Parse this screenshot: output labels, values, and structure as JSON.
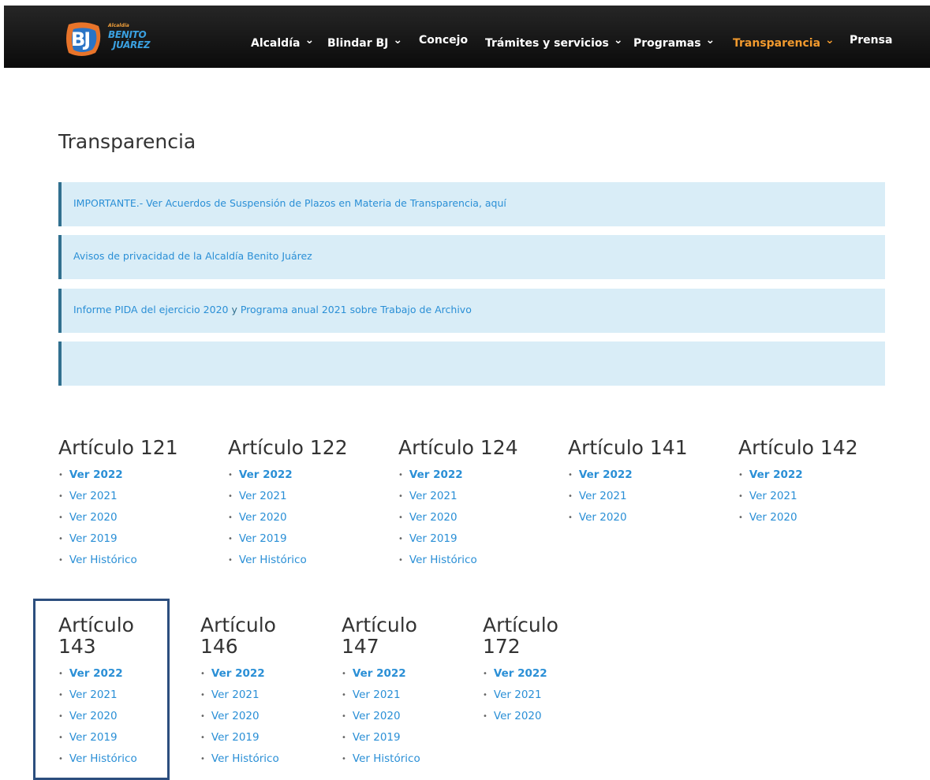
{
  "logo": {
    "small": "Alcaldía",
    "line1": "BENITO",
    "line2": "JUÁREZ",
    "mark": "BJ"
  },
  "nav": [
    {
      "label": "Alcaldía",
      "chevron": true,
      "active": false
    },
    {
      "label": "Blindar BJ",
      "chevron": true,
      "active": false
    },
    {
      "label": "Concejo",
      "chevron": false,
      "active": false
    },
    {
      "label": "Trámites y servicios",
      "chevron": true,
      "active": false
    },
    {
      "label": "Programas",
      "chevron": true,
      "active": false
    },
    {
      "label": "Transparencia",
      "chevron": true,
      "active": true
    },
    {
      "label": "Prensa",
      "chevron": false,
      "active": false
    }
  ],
  "page_title": "Transparencia",
  "notices": [
    {
      "parts": [
        {
          "text": "IMPORTANTE.- Ver Acuerdos de Suspensión de Plazos en Materia de Transparencia, aquí",
          "link": true
        }
      ]
    },
    {
      "parts": [
        {
          "text": "Avisos de privacidad de la Alcaldía Benito Juárez",
          "link": true
        }
      ]
    },
    {
      "parts": [
        {
          "text": "Informe PIDA del ejercicio 2020",
          "link": true
        },
        {
          "text": " y ",
          "link": false
        },
        {
          "text": "Programa anual 2021 sobre Trabajo de Archivo",
          "link": true
        }
      ]
    },
    {
      "parts": []
    }
  ],
  "articles_row1": [
    {
      "title": "Artículo 121",
      "links": [
        "Ver 2022",
        "Ver 2021",
        "Ver 2020",
        "Ver 2019",
        "Ver Histórico"
      ]
    },
    {
      "title": "Artículo 122",
      "links": [
        "Ver 2022",
        "Ver 2021",
        "Ver 2020",
        "Ver 2019",
        "Ver Histórico"
      ]
    },
    {
      "title": "Artículo 124",
      "links": [
        "Ver 2022",
        "Ver 2021",
        "Ver 2020",
        "Ver 2019",
        "Ver Histórico"
      ]
    },
    {
      "title": "Artículo 141",
      "links": [
        "Ver 2022",
        "Ver 2021",
        "Ver 2020"
      ]
    },
    {
      "title": "Artículo 142",
      "links": [
        "Ver 2022",
        "Ver 2021",
        "Ver 2020"
      ]
    }
  ],
  "articles_row2": [
    {
      "title": "Artículo 143",
      "links": [
        "Ver 2022",
        "Ver 2021",
        "Ver 2020",
        "Ver 2019",
        "Ver Histórico"
      ]
    },
    {
      "title": "Artículo 146",
      "links": [
        "Ver 2022",
        "Ver 2021",
        "Ver 2020",
        "Ver 2019",
        "Ver Histórico"
      ]
    },
    {
      "title": "Artículo 147",
      "links": [
        "Ver 2022",
        "Ver 2021",
        "Ver 2020",
        "Ver 2019",
        "Ver Histórico"
      ]
    },
    {
      "title": "Artículo 172",
      "links": [
        "Ver 2022",
        "Ver 2021",
        "Ver 2020"
      ]
    }
  ],
  "colors": {
    "accent": "#f29a2e",
    "link": "#2a8fd6",
    "notice_bg": "#d9edf7",
    "notice_border": "#31708f",
    "highlight": "#2c4e7e"
  }
}
